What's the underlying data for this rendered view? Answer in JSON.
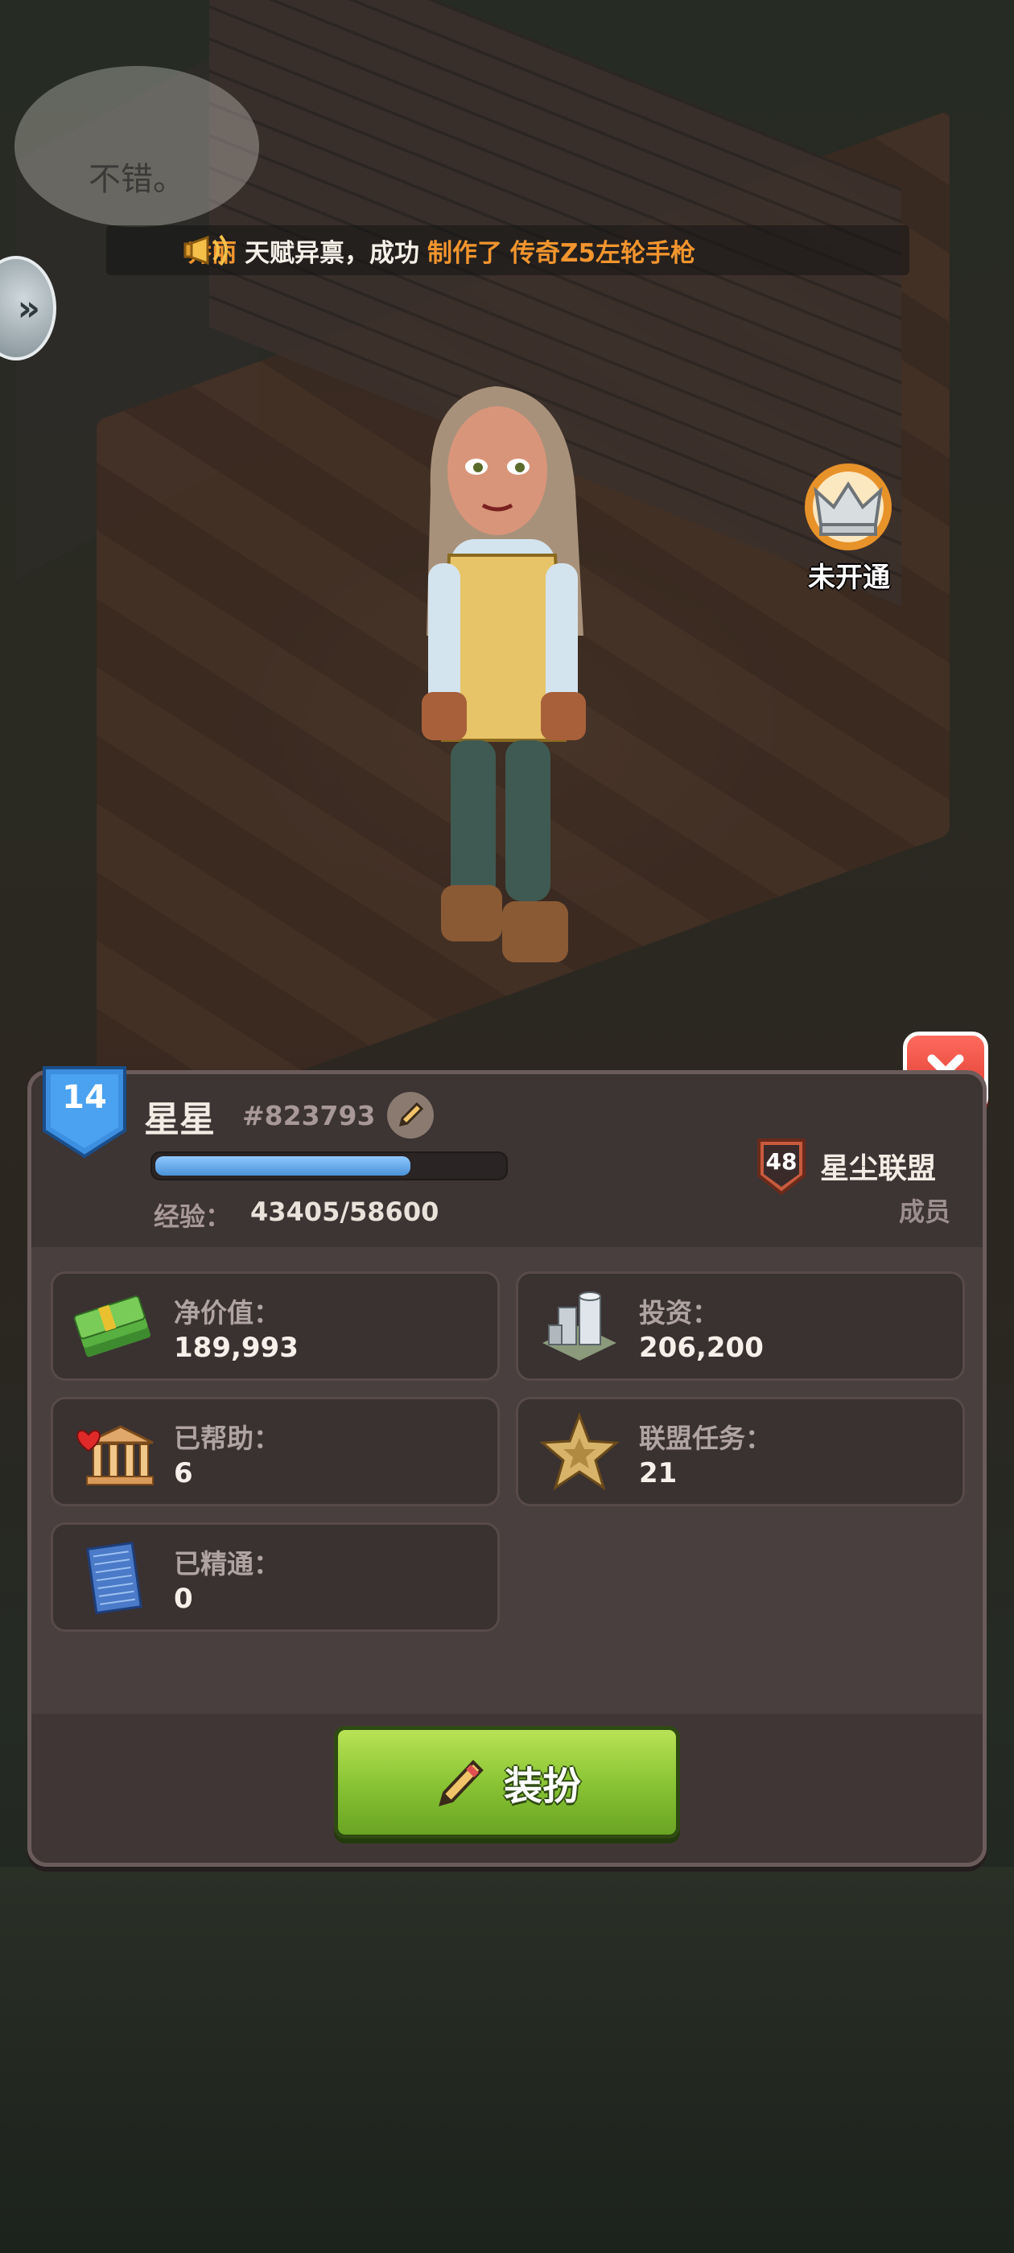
{
  "speech_bubble": {
    "text": "不错。"
  },
  "news_ticker": {
    "parts": [
      {
        "text": "乔丽",
        "color": "#f2952e"
      },
      {
        "text": "天赋异禀，成功",
        "color": "#f5f1e8"
      },
      {
        "text": "制作了",
        "color": "#f2952e"
      },
      {
        "text": "传奇Z5左轮手枪",
        "color": "#f2952e"
      }
    ]
  },
  "side_button": {
    "icon": "double-chevron-right-icon"
  },
  "crown_badge": {
    "label": "未开通",
    "icon": "crown-icon"
  },
  "player": {
    "level": "14",
    "name": "星星",
    "id": "#823793",
    "xp_label": "经验：",
    "xp_value": "43405/58600",
    "xp_progress": 0.74
  },
  "alliance": {
    "level": "48",
    "name": "星尘联盟",
    "role": "成员"
  },
  "stats": [
    {
      "label": "净价值：",
      "value": "189,993",
      "icon": "cash-stack-icon"
    },
    {
      "label": "投资：",
      "value": "206,200",
      "icon": "building-icon"
    },
    {
      "label": "已帮助：",
      "value": "6",
      "icon": "charity-bank-icon"
    },
    {
      "label": "联盟任务：",
      "value": "21",
      "icon": "sheriff-star-icon"
    },
    {
      "label": "已精通：",
      "value": "0",
      "icon": "blueprint-icon"
    }
  ],
  "dress_button": {
    "label": "装扮",
    "icon": "pencil-icon"
  },
  "colors": {
    "panel_bg": "#4a3f3f",
    "accent_green": "#86c232",
    "close_red": "#d9342a",
    "xp_blue": "#4a92d8",
    "highlight_orange": "#f2952e"
  }
}
